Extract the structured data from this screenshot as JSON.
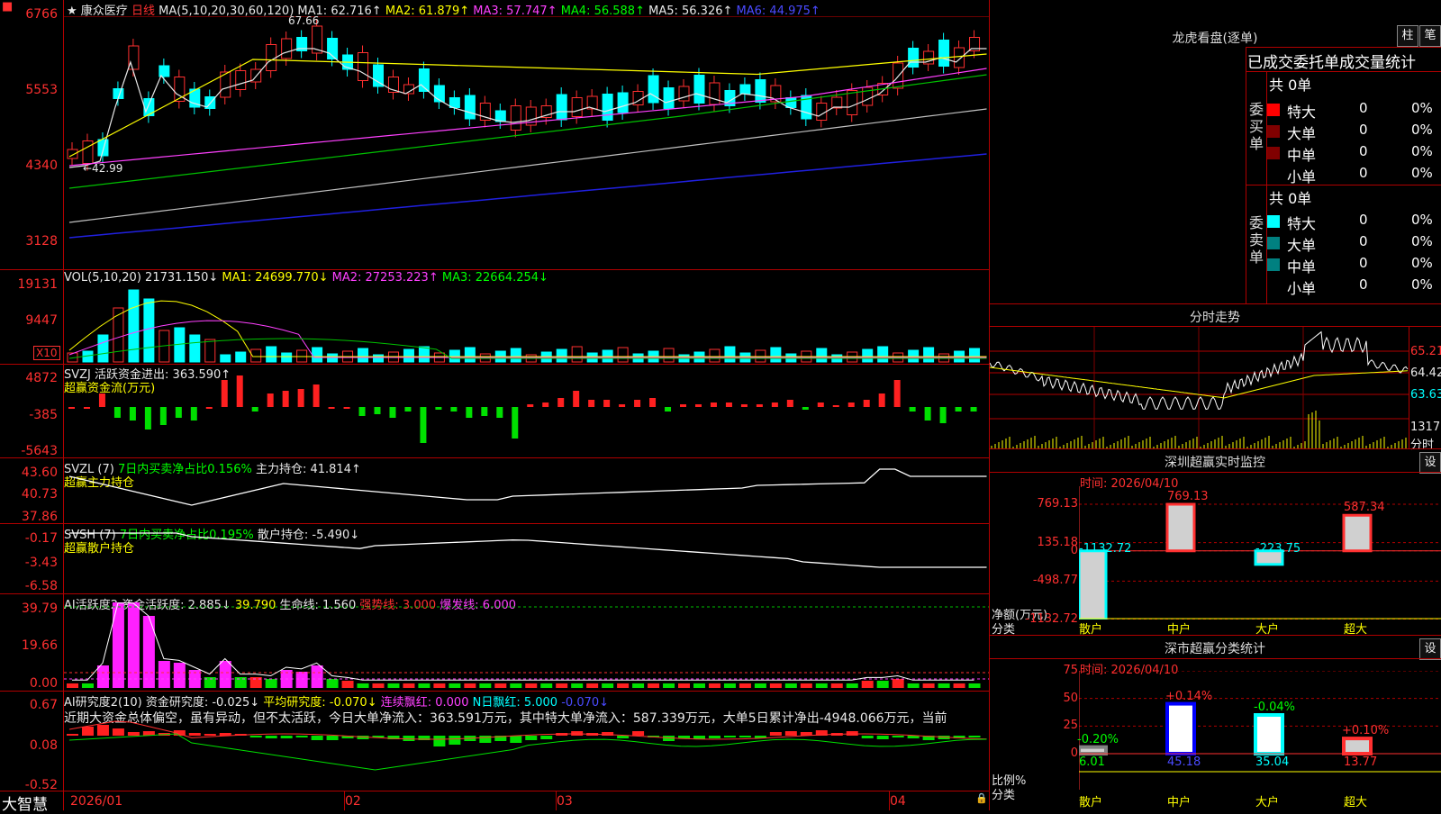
{
  "chart_header": {
    "stock_name": "康众医疗",
    "period": "日线",
    "ma_title": "MA(5,10,20,30,60,120)",
    "ma1": "MA1: 62.716↑",
    "ma2": "MA2: 61.879↑",
    "ma3": "MA3: 57.747↑",
    "ma4": "MA4: 56.588↑",
    "ma5": "MA5: 56.326↑",
    "ma6": "MA6: 44.975↑",
    "high_mark": "67.66",
    "low_mark": "←42.99"
  },
  "price_axis": [
    "6766",
    "5553",
    "4340",
    "3128"
  ],
  "volume_panel": {
    "title": "VOL(5,10,20)",
    "vol": "21731.150↓",
    "ma1": "MA1: 24699.770↓",
    "ma2": "MA2: 27253.223↑",
    "ma3": "MA3: 22664.254↓",
    "axis": [
      "19131",
      "9447"
    ],
    "unit": "X10"
  },
  "svzj_panel": {
    "title": "SVZJ",
    "label": "活跃资金进出: 363.590↑",
    "subtitle": "超赢资金流(万元)",
    "axis": [
      "4872",
      "-385",
      "-5643"
    ]
  },
  "svzl_panel": {
    "title": "SVZL (7)",
    "label1": "7日内买卖净占比0.156%",
    "label2": "主力持仓: 41.814↑",
    "subtitle": "超赢主力持仓",
    "axis": [
      "43.60",
      "40.73",
      "37.86"
    ]
  },
  "svsh_panel": {
    "title": "SVSH (7)",
    "label1": "7日内买卖净占比0.195%",
    "label2": "散户持仓: -5.490↓",
    "subtitle": "超赢散户持仓",
    "axis": [
      "-0.17",
      "-3.43",
      "-6.58"
    ]
  },
  "ai_active_panel": {
    "title": "AI活跃度2",
    "label1": "资金活跃度: 2.885↓",
    "label2": "39.790",
    "label3": "生命线: 1.560",
    "label4": "强势线: 3.000",
    "label5": "爆发线: 6.000",
    "axis": [
      "39.79",
      "19.66",
      "0.00"
    ]
  },
  "ai_research_panel": {
    "title": "AI研究度2(10)",
    "label1": "资金研究度: -0.025↓",
    "label2": "平均研究度: -0.070↓",
    "label3": "连续飘红: 0.000",
    "label4": "N日飘红: 5.000",
    "label5": "-0.070↓",
    "commentary": "近期大资金总体偏空，虽有异动，但不太活跃，今日大单净流入：363.591万元，其中特大单净流入：587.339万元，大单5日累计净出-4948.066万元，当前",
    "axis": [
      "0.67",
      "0.08",
      "-0.52"
    ]
  },
  "time_axis": [
    "2026/01",
    "02",
    "03",
    "04"
  ],
  "brand": "大智慧",
  "dragon_tiger": {
    "title": "龙虎看盘(逐单)",
    "btn_bar": "柱",
    "btn_pen": "笔",
    "tabs": "已成交委托单成交量统计",
    "buy_header": "共 0单",
    "buy_side_label": "委买单",
    "sell_header": "共 0单",
    "sell_side_label": "委卖单",
    "rows": [
      "特大",
      "大单",
      "中单",
      "小单"
    ],
    "zero": "0",
    "pct": "0%",
    "buy_colors": [
      "#ff0000",
      "#800000",
      "#800000",
      "#000000"
    ],
    "sell_colors": [
      "#00ffff",
      "#008080",
      "#008080",
      "#000000"
    ]
  },
  "intraday": {
    "title": "分时走势",
    "prices": [
      "65.21",
      "64.42",
      "63.63"
    ],
    "volume_label": "1317",
    "volume_unit": "分时"
  },
  "sz_monitor": {
    "title": "深圳超赢实时监控",
    "btn": "设",
    "time": "时间: 2026/04/10",
    "axis": [
      "769.13",
      "135.18",
      "0",
      "-498.77",
      "-1132.72"
    ],
    "y_caption_1": "净额(万元)",
    "y_caption_2": "分类",
    "categories": [
      "散户",
      "中户",
      "大户",
      "超大"
    ],
    "chart_data": {
      "type": "bar",
      "categories": [
        "散户",
        "中户",
        "大户",
        "超大"
      ],
      "values": [
        -1132.72,
        769.13,
        -223.75,
        587.34
      ],
      "ylim": [
        -1132.72,
        769.13
      ]
    },
    "value_labels": [
      "-1132.72",
      "769.13",
      "-223.75",
      "587.34"
    ]
  },
  "sz_class": {
    "title": "深市超赢分类统计",
    "btn": "设",
    "time": "时间: 2026/04/10",
    "axis": [
      "75",
      "50",
      "25",
      "0"
    ],
    "y_caption_1": "比例%",
    "y_caption_2": "分类",
    "categories": [
      "散户",
      "中户",
      "大户",
      "超大"
    ],
    "chart_data": {
      "type": "bar",
      "categories": [
        "散户",
        "中户",
        "大户",
        "超大"
      ],
      "values": [
        6.01,
        45.18,
        35.04,
        13.77
      ],
      "ylim": [
        0,
        75
      ]
    },
    "value_labels": [
      "6.01",
      "45.18",
      "35.04",
      "13.77"
    ],
    "change_labels": [
      "-0.20%",
      "+0.14%",
      "-0.04%",
      "+0.10%"
    ]
  }
}
